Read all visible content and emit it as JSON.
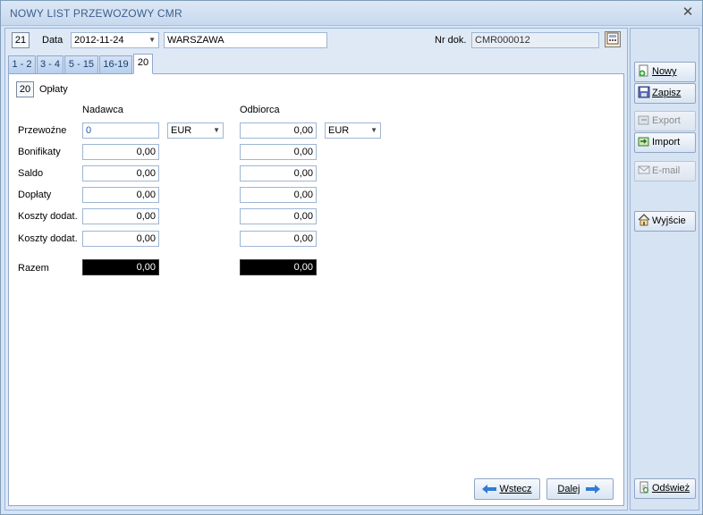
{
  "window": {
    "title": "NOWY LIST PRZEWOZOWY CMR",
    "close_glyph": "✕"
  },
  "header": {
    "section_number": "21",
    "date_label": "Data",
    "date_value": "2012-11-24",
    "place_value": "WARSZAWA",
    "doc_number_label": "Nr dok.",
    "doc_number_value": "CMR000012"
  },
  "tabs": [
    {
      "label": "1 - 2"
    },
    {
      "label": "3 - 4"
    },
    {
      "label": "5 - 15"
    },
    {
      "label": "16-19"
    },
    {
      "label": "20"
    }
  ],
  "active_tab": "20",
  "section": {
    "number": "20",
    "title": "Opłaty",
    "sender_header": "Nadawca",
    "receiver_header": "Odbiorca",
    "rows": [
      {
        "label": "Przewoźne",
        "sender": "0",
        "receiver": "0,00"
      },
      {
        "label": "Bonifikaty",
        "sender": "0,00",
        "receiver": "0,00"
      },
      {
        "label": "Saldo",
        "sender": "0,00",
        "receiver": "0,00"
      },
      {
        "label": "Dopłaty",
        "sender": "0,00",
        "receiver": "0,00"
      },
      {
        "label": "Koszty dodat.",
        "sender": "0,00",
        "receiver": "0,00"
      },
      {
        "label": "Koszty dodat.",
        "sender": "0,00",
        "receiver": "0,00"
      }
    ],
    "sender_currency": "EUR",
    "receiver_currency": "EUR",
    "total_label": "Razem",
    "total_sender": "0,00",
    "total_receiver": "0,00"
  },
  "nav": {
    "back_label": "Wstecz",
    "next_label": "Dalej"
  },
  "sidebar": {
    "new_label": "Nowy",
    "save_label": "Zapisz",
    "export_label": "Export",
    "import_label": "Import",
    "email_label": "E-mail",
    "exit_label": "Wyjście",
    "refresh_label": "Odśwież"
  },
  "icons": {
    "new": "plus-circle-icon",
    "save": "floppy-disk-icon",
    "export": "export-icon",
    "import": "import-icon",
    "email": "envelope-icon",
    "exit": "house-icon",
    "refresh": "refresh-document-icon",
    "calc": "calculator-icon",
    "back": "arrow-left-icon",
    "next": "arrow-right-icon"
  },
  "colors": {
    "title_text": "#3c5f8c",
    "total_field_bg": "#000000",
    "total_field_text": "#ffffff",
    "arrow_blue": "#2f7bd6"
  }
}
